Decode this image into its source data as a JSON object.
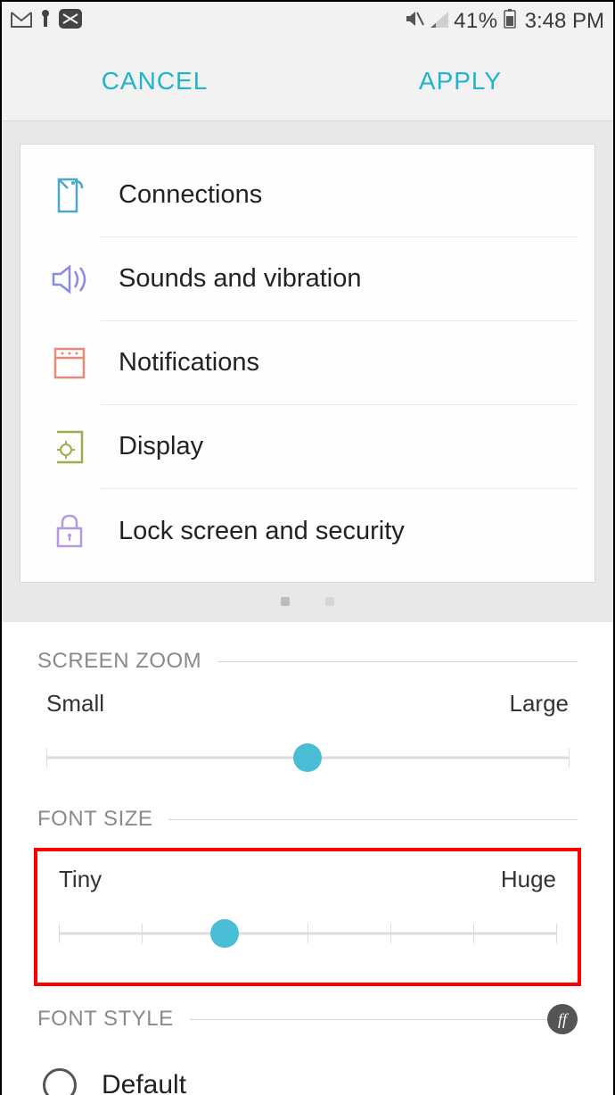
{
  "status": {
    "battery_pct": "41%",
    "time": "3:48 PM"
  },
  "actions": {
    "cancel": "CANCEL",
    "apply": "APPLY"
  },
  "preview": {
    "items": [
      {
        "label": "Connections",
        "icon": "data-icon"
      },
      {
        "label": "Sounds and vibration",
        "icon": "sound-icon"
      },
      {
        "label": "Notifications",
        "icon": "notifications-icon"
      },
      {
        "label": "Display",
        "icon": "display-icon"
      },
      {
        "label": "Lock screen and security",
        "icon": "lock-icon"
      }
    ]
  },
  "screen_zoom": {
    "title": "SCREEN ZOOM",
    "min_label": "Small",
    "max_label": "Large",
    "steps": 3,
    "value_index": 1
  },
  "font_size": {
    "title": "FONT SIZE",
    "min_label": "Tiny",
    "max_label": "Huge",
    "steps": 7,
    "value_index": 2
  },
  "font_style": {
    "title": "FONT STYLE",
    "selected": "Default"
  }
}
